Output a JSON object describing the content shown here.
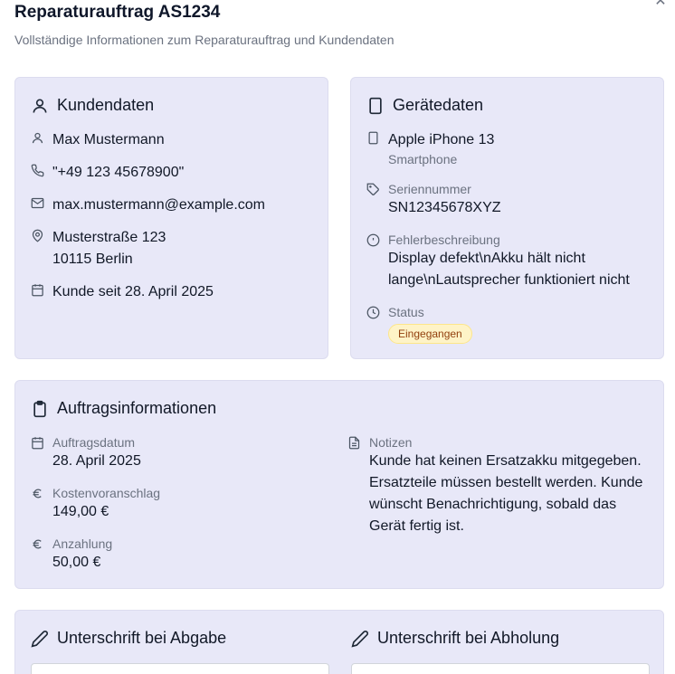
{
  "dialog": {
    "title": "Reparaturauftrag AS1234",
    "subtitle": "Vollständige Informationen zum Reparaturauftrag und Kundendaten"
  },
  "customer": {
    "title": "Kundendaten",
    "name": "Max Mustermann",
    "phone": "\"+49 123 45678900\"",
    "email": "max.mustermann@example.com",
    "street": "Musterstraße 123",
    "city": "10115 Berlin",
    "since": "Kunde seit 28. April 2025"
  },
  "device": {
    "title": "Gerätedaten",
    "model": "Apple iPhone 13",
    "type": "Smartphone",
    "serial_label": "Seriennummer",
    "serial": "SN12345678XYZ",
    "fault_label": "Fehlerbeschreibung",
    "fault_line1": "Display defekt\\nAkku hält nicht",
    "fault_line2": "lange\\nLautsprecher funktioniert nicht",
    "status_label": "Status",
    "status": "Eingegangen"
  },
  "order": {
    "title": "Auftragsinformationen",
    "date_label": "Auftragsdatum",
    "date": "28. April 2025",
    "estimate_label": "Kostenvoranschlag",
    "estimate": "149,00 €",
    "deposit_label": "Anzahlung",
    "deposit": "50,00 €",
    "notes_label": "Notizen",
    "notes_lines": [
      "Kunde hat keinen Ersatzakku mitgegeben.",
      "Ersatzteile müssen bestellt werden. Kunde",
      "wünscht Benachrichtigung, sobald das",
      "Gerät fertig ist."
    ]
  },
  "signatures": {
    "dropoff_title": "Unterschrift bei Abgabe",
    "pickup_title": "Unterschrift bei Abholung"
  }
}
